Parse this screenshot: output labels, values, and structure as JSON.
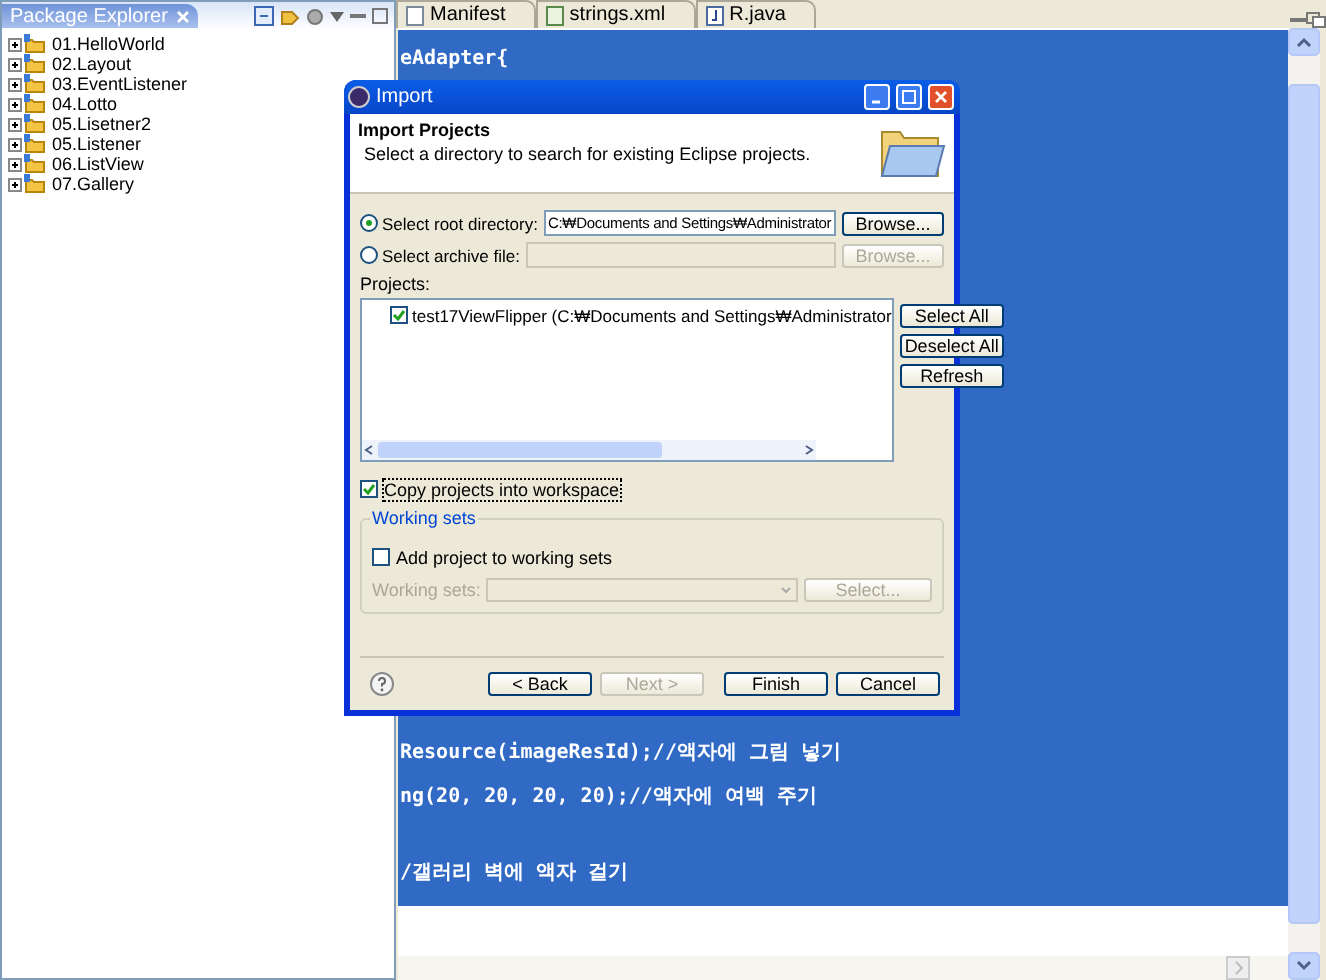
{
  "explorer": {
    "title": "Package Explorer",
    "projects": [
      {
        "label": "01.HelloWorld",
        "expanded": false
      },
      {
        "label": "02.Layout",
        "expanded": false
      },
      {
        "label": "03.EventListener",
        "expanded": false
      },
      {
        "label": "04.Lotto",
        "expanded": false
      },
      {
        "label": "05.Lisetner2",
        "expanded": false
      },
      {
        "label": "05.Listener",
        "expanded": false
      },
      {
        "label": "06.ListView",
        "expanded": false
      },
      {
        "label": "07.Gallery",
        "expanded": false
      }
    ]
  },
  "editor": {
    "tabs": [
      {
        "label": "Manifest",
        "selected": false
      },
      {
        "label": "strings.xml",
        "selected": false
      },
      {
        "label": "R.java",
        "selected": false
      }
    ],
    "code_lines": [
      "eAdapter{",
      "Resource(imageResId);//액자에 그림 넣기",
      "ng(20, 20, 20, 20);//액자에 여백 주기",
      "/갤러리 벽에 액자 걸기"
    ]
  },
  "dialog": {
    "title": "Import",
    "heading": "Import Projects",
    "description": "Select a directory to search for existing Eclipse projects.",
    "sources": [
      {
        "label": "Select root directory:",
        "selected": true,
        "value": "C:₩Documents and Settings₩Administrator",
        "button": {
          "label": "Browse...",
          "disabled": false
        }
      },
      {
        "label": "Select archive file:",
        "selected": false,
        "button": {
          "label": "Browse...",
          "disabled": true
        }
      }
    ],
    "projects_label": "Projects:",
    "projects": [
      {
        "label": "test17ViewFlipper (C:₩Documents and Settings₩Administrator",
        "checked": true
      }
    ],
    "list_buttons": [
      "Select All",
      "Deselect All",
      "Refresh"
    ],
    "copy_option": {
      "label": "Copy projects into workspace",
      "checked": true
    },
    "working_sets": {
      "title": "Working sets",
      "option": {
        "label": "Add project to working sets",
        "checked": false
      },
      "field_label": "Working sets:",
      "select_button": "Select...",
      "disabled": true
    },
    "buttons": [
      {
        "label": "< Back",
        "disabled": false
      },
      {
        "label": "Next >",
        "disabled": true
      },
      {
        "label": "Finish",
        "disabled": false
      },
      {
        "label": "Cancel",
        "disabled": false
      }
    ]
  }
}
